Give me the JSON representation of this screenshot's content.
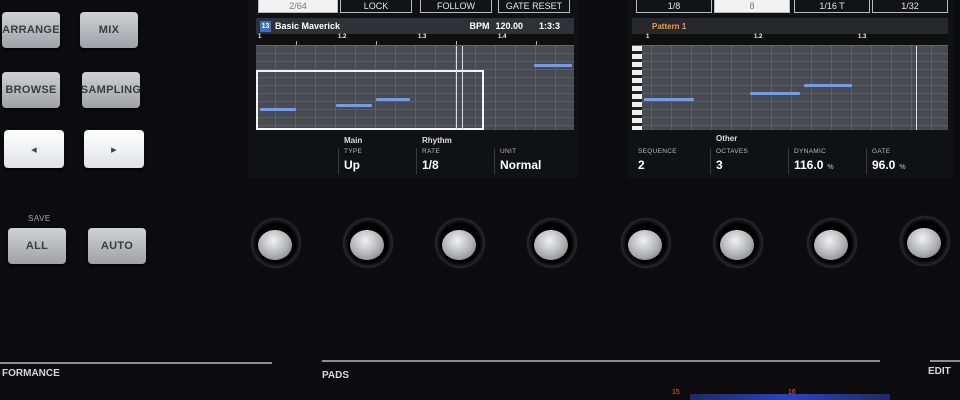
{
  "hardware": {
    "arrange": "ARRANGE",
    "mix": "MIX",
    "browse": "BROWSE",
    "sampling": "SAMPLING",
    "prev_arrow": "◂",
    "next_arrow": "▸",
    "save_caption": "SAVE",
    "all": "ALL",
    "auto": "AUTO"
  },
  "left_screen": {
    "top_buttons": [
      "2/64",
      "LOCK",
      "FOLLOW",
      "GATE RESET"
    ],
    "group_number": "13",
    "title": "Basic Maverick",
    "bpm_label": "BPM",
    "bpm_value": "120.00",
    "position": "1:3:3",
    "ruler": [
      "1",
      "1.2",
      "1.3",
      "1.4"
    ],
    "section_main": "Main",
    "section_rhythm": "Rhythm",
    "params": [
      {
        "label": "TYPE",
        "value": "Up"
      },
      {
        "label": "RATE",
        "value": "1/8"
      },
      {
        "label": "UNIT",
        "value": "Normal"
      }
    ]
  },
  "right_screen": {
    "top_buttons": [
      "1/8",
      "8",
      "1/16 T",
      "1/32"
    ],
    "pattern_title": "Pattern 1",
    "ruler": [
      "1",
      "1.2",
      "1.3"
    ],
    "section_other": "Other",
    "params": [
      {
        "label": "SEQUENCE",
        "value": "2",
        "unit": ""
      },
      {
        "label": "OCTAVES",
        "value": "3",
        "unit": ""
      },
      {
        "label": "DYNAMIC",
        "value": "116.0",
        "unit": "%"
      },
      {
        "label": "GATE",
        "value": "96.0",
        "unit": "%"
      }
    ]
  },
  "bottom": {
    "performance_label": "FORMANCE",
    "pads_label": "PADS",
    "edit_label": "EDIT",
    "pad_15": "15",
    "pad_16": "16"
  },
  "colors": {
    "note": "#6f9bff",
    "group_badge": "#3b6ec7",
    "pattern_title": "#f0a23a",
    "pad_number": "#ff5a4d"
  }
}
